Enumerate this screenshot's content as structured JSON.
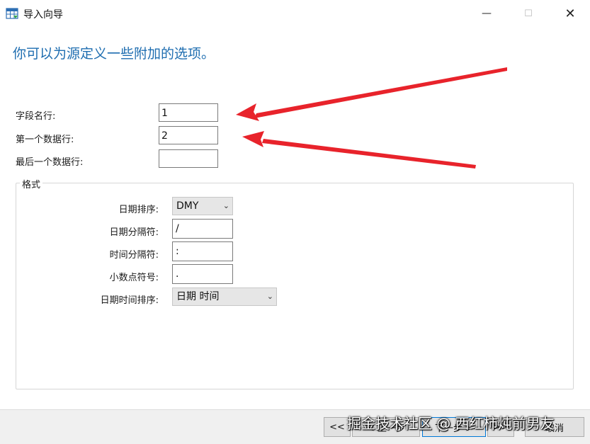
{
  "window": {
    "title": "导入向导",
    "minimize": "—",
    "maximize": "☐",
    "close": "✕"
  },
  "heading": "你可以为源定义一些附加的选项。",
  "fields": {
    "field_name_row": {
      "label": "字段名行:",
      "value": "1"
    },
    "first_data_row": {
      "label": "第一个数据行:",
      "value": "2"
    },
    "last_data_row": {
      "label": "最后一个数据行:",
      "value": ""
    }
  },
  "format": {
    "legend": "格式",
    "date_order": {
      "label": "日期排序:",
      "value": "DMY"
    },
    "date_separator": {
      "label": "日期分隔符:",
      "value": "/"
    },
    "time_separator": {
      "label": "时间分隔符:",
      "value": ":"
    },
    "decimal_symbol": {
      "label": "小数点符号:",
      "value": "."
    },
    "datetime_order": {
      "label": "日期时间排序:",
      "value": "日期 时间"
    }
  },
  "buttons": {
    "first": "<<",
    "back": "< 上一步",
    "next": "下一步 >",
    "last": ">>",
    "cancel": "取消"
  },
  "watermark": "掘金技术社区 @ 西红柿炖前男友",
  "colors": {
    "heading": "#1e6db0",
    "annotation_arrow": "#e8232b",
    "primary_button_border": "#0078d7"
  },
  "icons": {
    "app": "table-import-icon",
    "combo": "chevron-down-icon"
  }
}
